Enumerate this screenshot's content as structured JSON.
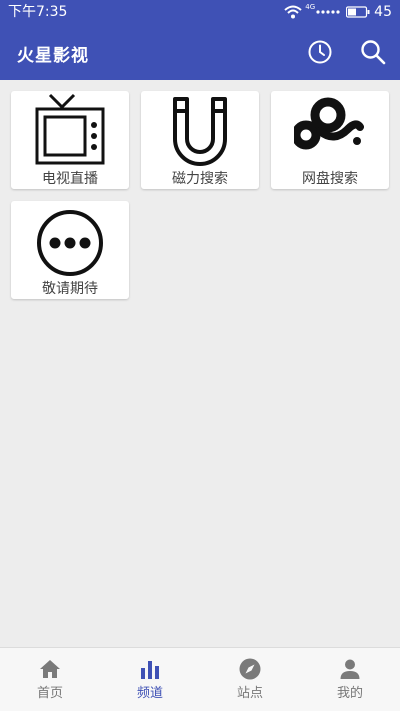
{
  "status_bar": {
    "time": "下午7:35",
    "battery_level": "45",
    "network": "4G"
  },
  "app": {
    "title": "火星影视",
    "actions": [
      "history-icon",
      "search-icon"
    ]
  },
  "channels": [
    {
      "label": "电视直播",
      "icon": "tv-icon"
    },
    {
      "label": "磁力搜索",
      "icon": "magnet-icon"
    },
    {
      "label": "网盘搜索",
      "icon": "cloud-drive-icon"
    },
    {
      "label": "敬请期待",
      "icon": "more-icon"
    }
  ],
  "bottom_nav": {
    "active": "频道",
    "items": [
      {
        "label": "首页",
        "icon": "home-icon"
      },
      {
        "label": "频道",
        "icon": "bar-chart-icon"
      },
      {
        "label": "站点",
        "icon": "compass-icon"
      },
      {
        "label": "我的",
        "icon": "user-icon"
      }
    ]
  },
  "colors": {
    "primary": "#3f51b5",
    "background": "#ededed",
    "inactive_nav": "#777777"
  }
}
